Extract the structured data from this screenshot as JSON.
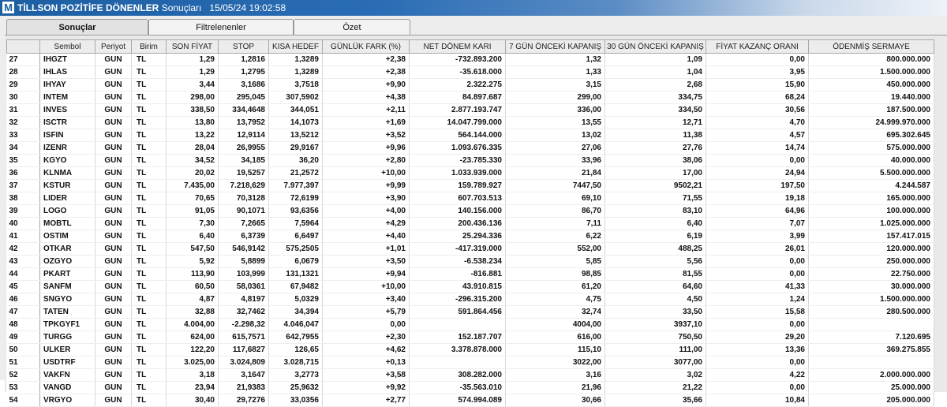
{
  "window": {
    "logo": "M",
    "title": "TİLLSON POZİTİFE DÖNENLER",
    "subtitle": "Sonuçları",
    "timestamp": "15/05/24 19:02:58"
  },
  "tabs": [
    {
      "label": "Sonuçlar"
    },
    {
      "label": "Filtrelenenler"
    },
    {
      "label": "Özet"
    }
  ],
  "table": {
    "columns": [
      "",
      "Sembol",
      "Periyot",
      "Birim",
      "SON FİYAT",
      "STOP",
      "KISA HEDEF",
      "GÜNLÜK FARK (%)",
      "NET DÖNEM KARI",
      "7 GÜN ÖNCEKİ KAPANIŞ",
      "30 GÜN ÖNCEKİ KAPANIŞ",
      "FİYAT KAZANÇ ORANI",
      "ÖDENMİŞ SERMAYE"
    ],
    "rows": [
      [
        "27",
        "IHGZT",
        "GUN",
        "TL",
        "1,29",
        "1,2816",
        "1,3289",
        "+2,38",
        "-732.893.200",
        "1,32",
        "1,09",
        "0,00",
        "800.000.000"
      ],
      [
        "28",
        "IHLAS",
        "GUN",
        "TL",
        "1,29",
        "1,2795",
        "1,3289",
        "+2,38",
        "-35.618.000",
        "1,33",
        "1,04",
        "3,95",
        "1.500.000.000"
      ],
      [
        "29",
        "IHYAY",
        "GUN",
        "TL",
        "3,44",
        "3,1686",
        "3,7518",
        "+9,90",
        "2.322.275",
        "3,15",
        "2,68",
        "15,90",
        "450.000.000"
      ],
      [
        "30",
        "INTEM",
        "GUN",
        "TL",
        "298,00",
        "295,045",
        "307,5902",
        "+4,38",
        "84.897.687",
        "299,00",
        "334,75",
        "68,24",
        "19.440.000"
      ],
      [
        "31",
        "INVES",
        "GUN",
        "TL",
        "338,50",
        "334,4648",
        "344,051",
        "+2,11",
        "2.877.193.747",
        "336,00",
        "334,50",
        "30,56",
        "187.500.000"
      ],
      [
        "32",
        "ISCTR",
        "GUN",
        "TL",
        "13,80",
        "13,7952",
        "14,1073",
        "+1,69",
        "14.047.799.000",
        "13,55",
        "12,71",
        "4,70",
        "24.999.970.000"
      ],
      [
        "33",
        "ISFIN",
        "GUN",
        "TL",
        "13,22",
        "12,9114",
        "13,5212",
        "+3,52",
        "564.144.000",
        "13,02",
        "11,38",
        "4,57",
        "695.302.645"
      ],
      [
        "34",
        "IZENR",
        "GUN",
        "TL",
        "28,04",
        "26,9955",
        "29,9167",
        "+9,96",
        "1.093.676.335",
        "27,06",
        "27,76",
        "14,74",
        "575.000.000"
      ],
      [
        "35",
        "KGYO",
        "GUN",
        "TL",
        "34,52",
        "34,185",
        "36,20",
        "+2,80",
        "-23.785.330",
        "33,96",
        "38,06",
        "0,00",
        "40.000.000"
      ],
      [
        "36",
        "KLNMA",
        "GUN",
        "TL",
        "20,02",
        "19,5257",
        "21,2572",
        "+10,00",
        "1.033.939.000",
        "21,84",
        "17,00",
        "24,94",
        "5.500.000.000"
      ],
      [
        "37",
        "KSTUR",
        "GUN",
        "TL",
        "7.435,00",
        "7.218,629",
        "7.977,397",
        "+9,99",
        "159.789.927",
        "7447,50",
        "9502,21",
        "197,50",
        "4.244.587"
      ],
      [
        "38",
        "LIDER",
        "GUN",
        "TL",
        "70,65",
        "70,3128",
        "72,6199",
        "+3,90",
        "607.703.513",
        "69,10",
        "71,55",
        "19,18",
        "165.000.000"
      ],
      [
        "39",
        "LOGO",
        "GUN",
        "TL",
        "91,05",
        "90,1071",
        "93,6356",
        "+4,00",
        "140.156.000",
        "86,70",
        "83,10",
        "64,96",
        "100.000.000"
      ],
      [
        "40",
        "MOBTL",
        "GUN",
        "TL",
        "7,30",
        "7,2665",
        "7,5964",
        "+4,29",
        "200.436.136",
        "7,11",
        "6,40",
        "7,07",
        "1.025.000.000"
      ],
      [
        "41",
        "OSTIM",
        "GUN",
        "TL",
        "6,40",
        "6,3739",
        "6,6497",
        "+4,40",
        "25.294.336",
        "6,22",
        "6,19",
        "3,99",
        "157.417.015"
      ],
      [
        "42",
        "OTKAR",
        "GUN",
        "TL",
        "547,50",
        "546,9142",
        "575,2505",
        "+1,01",
        "-417.319.000",
        "552,00",
        "488,25",
        "26,01",
        "120.000.000"
      ],
      [
        "43",
        "OZGYO",
        "GUN",
        "TL",
        "5,92",
        "5,8899",
        "6,0679",
        "+3,50",
        "-6.538.234",
        "5,85",
        "5,56",
        "0,00",
        "250.000.000"
      ],
      [
        "44",
        "PKART",
        "GUN",
        "TL",
        "113,90",
        "103,999",
        "131,1321",
        "+9,94",
        "-816.881",
        "98,85",
        "81,55",
        "0,00",
        "22.750.000"
      ],
      [
        "45",
        "SANFM",
        "GUN",
        "TL",
        "60,50",
        "58,0361",
        "67,9482",
        "+10,00",
        "43.910.815",
        "61,20",
        "64,60",
        "41,33",
        "30.000.000"
      ],
      [
        "46",
        "SNGYO",
        "GUN",
        "TL",
        "4,87",
        "4,8197",
        "5,0329",
        "+3,40",
        "-296.315.200",
        "4,75",
        "4,50",
        "1,24",
        "1.500.000.000"
      ],
      [
        "47",
        "TATEN",
        "GUN",
        "TL",
        "32,88",
        "32,7462",
        "34,394",
        "+5,79",
        "591.864.456",
        "32,74",
        "33,50",
        "15,58",
        "280.500.000"
      ],
      [
        "48",
        "TPKGYF1",
        "GUN",
        "TL",
        "4.004,00",
        "-2.298,32",
        "4.046,047",
        "0,00",
        "",
        "4004,00",
        "3937,10",
        "0,00",
        ""
      ],
      [
        "49",
        "TURGG",
        "GUN",
        "TL",
        "624,00",
        "615,7571",
        "642,7955",
        "+2,30",
        "152.187.707",
        "616,00",
        "750,50",
        "29,20",
        "7.120.695"
      ],
      [
        "50",
        "ULKER",
        "GUN",
        "TL",
        "122,20",
        "117,6827",
        "126,65",
        "+4,62",
        "3.378.878.000",
        "115,10",
        "111,00",
        "13,36",
        "369.275.855"
      ],
      [
        "51",
        "USDTRF",
        "GUN",
        "TL",
        "3.025,00",
        "3.024,809",
        "3.028,715",
        "+0,13",
        "",
        "3022,00",
        "3077,00",
        "0,00",
        ""
      ],
      [
        "52",
        "VAKFN",
        "GUN",
        "TL",
        "3,18",
        "3,1647",
        "3,2773",
        "+3,58",
        "308.282.000",
        "3,16",
        "3,02",
        "4,22",
        "2.000.000.000"
      ],
      [
        "53",
        "VANGD",
        "GUN",
        "TL",
        "23,94",
        "21,9383",
        "25,9632",
        "+9,92",
        "-35.563.010",
        "21,96",
        "21,22",
        "0,00",
        "25.000.000"
      ],
      [
        "54",
        "VRGYO",
        "GUN",
        "TL",
        "30,40",
        "29,7276",
        "33,0356",
        "+2,77",
        "574.994.089",
        "30,66",
        "35,66",
        "10,84",
        "205.000.000"
      ]
    ]
  }
}
